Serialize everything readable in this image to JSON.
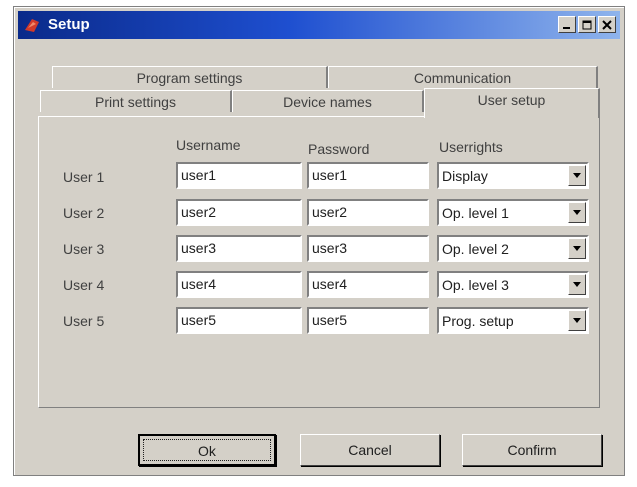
{
  "window": {
    "title": "Setup"
  },
  "tabs": {
    "program_settings": "Program settings",
    "communication": "Communication",
    "print_settings": "Print settings",
    "device_names": "Device names",
    "user_setup": "User setup"
  },
  "columns": {
    "username": "Username",
    "password": "Password",
    "userrights": "Userrights"
  },
  "users": [
    {
      "label": "User 1",
      "username": "user1",
      "password": "user1",
      "rights": "Display"
    },
    {
      "label": "User 2",
      "username": "user2",
      "password": "user2",
      "rights": "Op. level 1"
    },
    {
      "label": "User 3",
      "username": "user3",
      "password": "user3",
      "rights": "Op. level 2"
    },
    {
      "label": "User 4",
      "username": "user4",
      "password": "user4",
      "rights": "Op. level 3"
    },
    {
      "label": "User 5",
      "username": "user5",
      "password": "user5",
      "rights": "Prog. setup"
    }
  ],
  "buttons": {
    "ok": "Ok",
    "cancel": "Cancel",
    "confirm": "Confirm"
  },
  "icons": [
    "app-icon",
    "minimize-icon",
    "maximize-icon",
    "close-icon",
    "dropdown-arrow-icon"
  ]
}
